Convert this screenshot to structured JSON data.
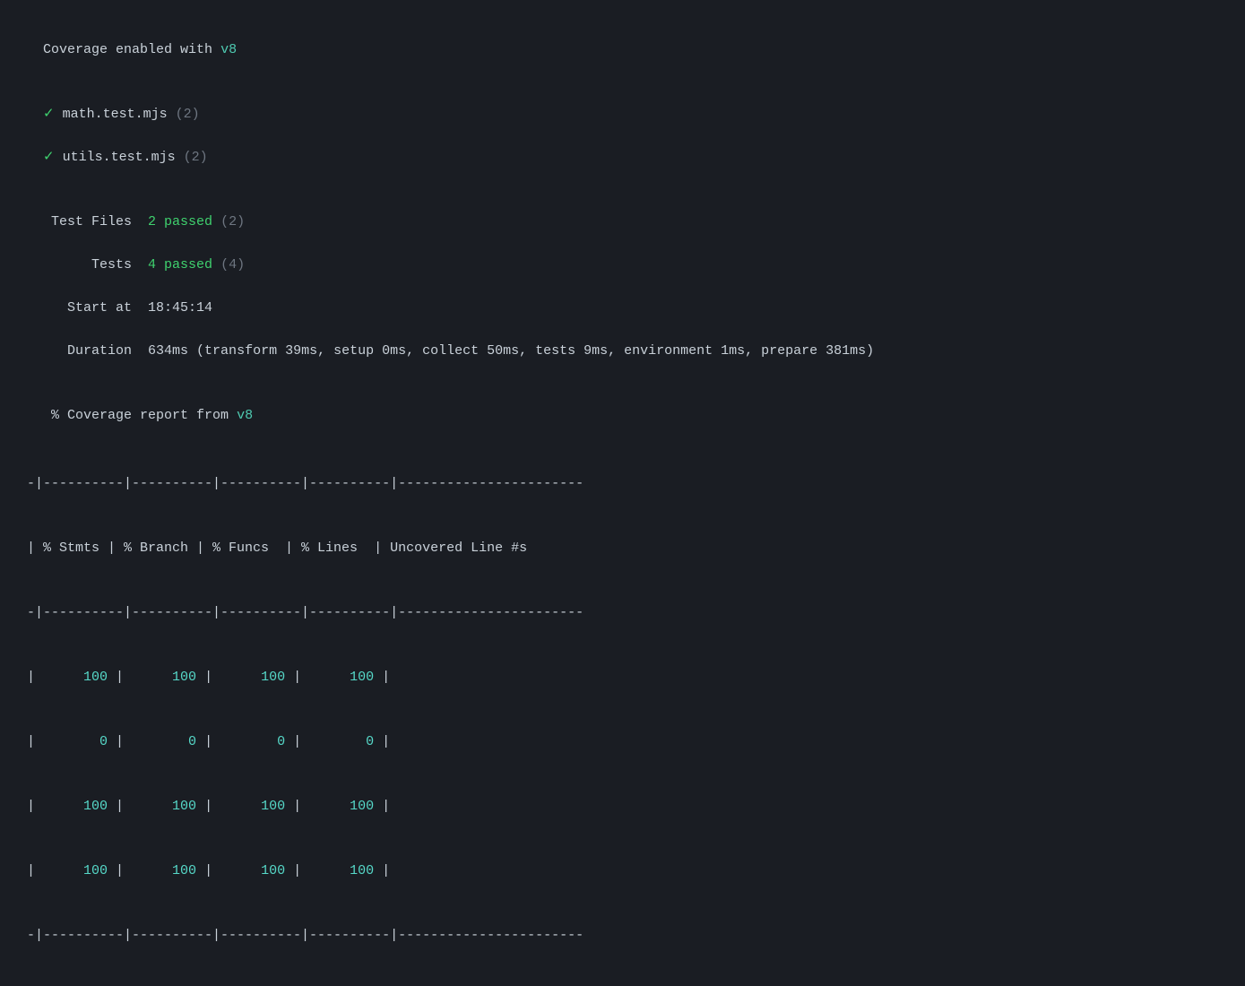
{
  "terminal": {
    "coverage_enabled_label": "Coverage enabled with ",
    "coverage_v8": "v8",
    "test_files": [
      {
        "icon": "✓",
        "name": "math.test.mjs",
        "count": "(2)"
      },
      {
        "icon": "✓",
        "name": "utils.test.mjs",
        "count": "(2)"
      }
    ],
    "summary": {
      "test_files_label": "Test Files",
      "test_files_passed_num": "2 passed",
      "test_files_total": "(2)",
      "tests_label": "Tests",
      "tests_passed_num": "4 passed",
      "tests_total": "(4)",
      "start_at_label": "Start at",
      "start_at_value": "18:45:14",
      "duration_label": "Duration",
      "duration_value": "634ms (transform 39ms, setup 0ms, collect 50ms, tests 9ms, environment 1ms, prepare 381ms)"
    },
    "coverage_report_label": "% Coverage report from ",
    "coverage_report_v8": "v8",
    "table": {
      "separator": "-|----------|----------|----------|----------|-----------------------",
      "header": "| % Stmts | % Branch | % Funcs  | % Lines  | Uncovered Line #s     ",
      "rows": [
        {
          "stmts": "100",
          "branch": "100",
          "funcs": "100",
          "lines": "100",
          "uncovered": ""
        },
        {
          "stmts": "0",
          "branch": "0",
          "funcs": "0",
          "lines": "0",
          "uncovered": ""
        },
        {
          "stmts": "100",
          "branch": "100",
          "funcs": "100",
          "lines": "100",
          "uncovered": ""
        },
        {
          "stmts": "100",
          "branch": "100",
          "funcs": "100",
          "lines": "100",
          "uncovered": ""
        }
      ]
    }
  }
}
